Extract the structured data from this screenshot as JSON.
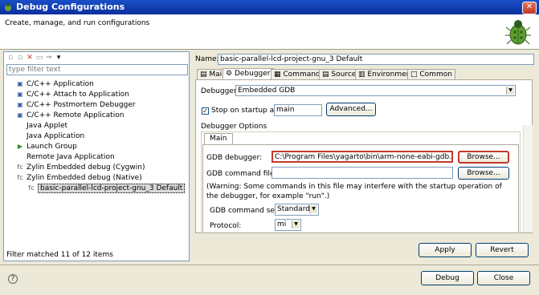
{
  "window": {
    "title": "Debug Configurations",
    "close_glyph": "✕",
    "subtitle": "Create, manage, and run configurations"
  },
  "toolbar": {
    "icons": [
      "new-config-icon",
      "duplicate-icon",
      "delete-icon",
      "collapse-icon",
      "filter-icon",
      "dropdown-arrow-icon"
    ]
  },
  "left": {
    "filter_placeholder": "type filter text",
    "items": [
      {
        "label": "C/C++ Application",
        "icon": "c-app-icon",
        "glyph": "▣",
        "color": "#3a5ea8"
      },
      {
        "label": "C/C++ Attach to Application",
        "icon": "c-attach-icon",
        "glyph": "▣",
        "color": "#3a5ea8"
      },
      {
        "label": "C/C++ Postmortem Debugger",
        "icon": "c-postmortem-icon",
        "glyph": "▣",
        "color": "#3a5ea8"
      },
      {
        "label": "C/C++ Remote Application",
        "icon": "c-remote-icon",
        "glyph": "▣",
        "color": "#3a5ea8"
      },
      {
        "label": "Java Applet",
        "icon": "java-applet-icon",
        "glyph": "",
        "color": "#888888"
      },
      {
        "label": "Java Application",
        "icon": "java-app-icon",
        "glyph": "",
        "color": "#888888"
      },
      {
        "label": "Launch Group",
        "icon": "launch-group-icon",
        "glyph": "▶",
        "color": "#2e8b2e"
      },
      {
        "label": "Remote Java Application",
        "icon": "remote-java-icon",
        "glyph": "",
        "color": "#888888"
      },
      {
        "label": "Zylin Embedded debug (Cygwin)",
        "icon": "zylin-cygwin-icon",
        "glyph": "fc",
        "color": "#555555"
      },
      {
        "label": "Zylin Embedded debug (Native)",
        "icon": "zylin-native-icon",
        "glyph": "fc",
        "color": "#555555"
      },
      {
        "label": "basic-parallel-lcd-project-gnu_3 Default",
        "icon": "config-icon",
        "glyph": "fc",
        "color": "#555555"
      }
    ],
    "status": "Filter matched 11 of 12 items"
  },
  "right": {
    "name_label": "Name:",
    "name_value": "basic-parallel-lcd-project-gnu_3 Default",
    "tabs": [
      {
        "label": "Main",
        "icon": "main-tab-icon",
        "glyph": "▤"
      },
      {
        "label": "Debugger",
        "icon": "debugger-tab-icon",
        "glyph": "⚙"
      },
      {
        "label": "Commands",
        "icon": "commands-tab-icon",
        "glyph": "▦"
      },
      {
        "label": "Source",
        "icon": "source-tab-icon",
        "glyph": "▤"
      },
      {
        "label": "Environment",
        "icon": "environment-tab-icon",
        "glyph": "▥"
      },
      {
        "label": "Common",
        "icon": "common-tab-icon",
        "glyph": "□"
      }
    ],
    "debugger_label": "Debugger:",
    "debugger_value": "Embedded GDB",
    "stop_check_mark": "✓",
    "stop_label": "Stop on startup at:",
    "stop_value": "main",
    "advanced_label": "Advanced...",
    "options_title": "Debugger Options",
    "inner_tab": "Main",
    "gdb_debugger_label": "GDB debugger:",
    "gdb_debugger_value": "C:\\Program Files\\yagarto\\bin\\arm-none-eabi-gdb.exe",
    "browse1": "Browse...",
    "gdb_command_file_label": "GDB command file:",
    "gdb_command_file_value": "",
    "browse2": "Browse...",
    "warning": "(Warning: Some commands in this file may interfere with the startup operation of the debugger, for example \"run\".)",
    "cmdset_label": "GDB command set:",
    "cmdset_value": "Standard",
    "protocol_label": "Protocol:",
    "protocol_value": "mi",
    "apply": "Apply",
    "revert": "Revert"
  },
  "footer": {
    "help_glyph": "?",
    "debug": "Debug",
    "close": "Close"
  },
  "colors": {
    "title_bar": "#1a4fc7",
    "highlight": "#c0392b"
  }
}
